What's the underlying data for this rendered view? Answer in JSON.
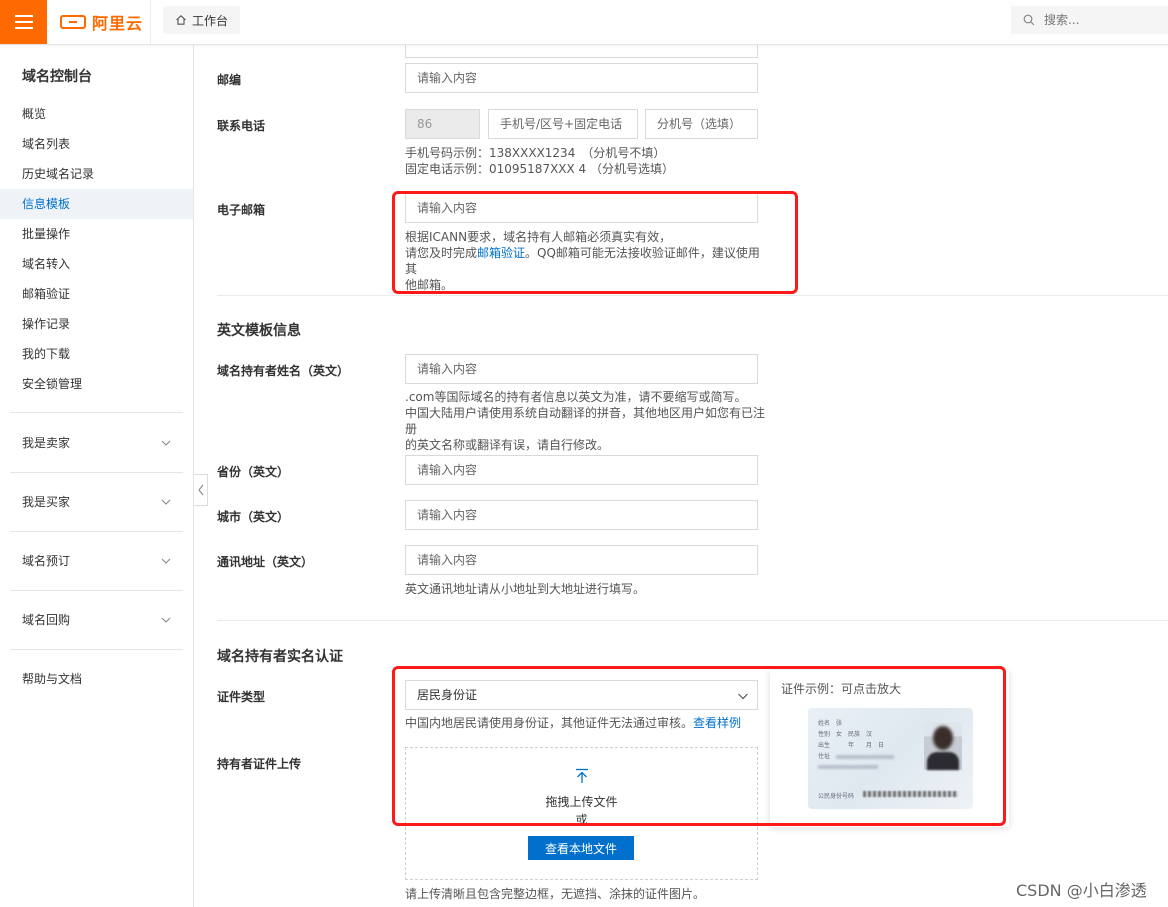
{
  "topbar": {
    "logo_text": "阿里云",
    "workbench_label": "工作台",
    "search_placeholder": "搜索..."
  },
  "sidebar": {
    "title": "域名控制台",
    "items": [
      {
        "label": "概览"
      },
      {
        "label": "域名列表"
      },
      {
        "label": "历史域名记录"
      },
      {
        "label": "信息模板"
      },
      {
        "label": "批量操作"
      },
      {
        "label": "域名转入"
      },
      {
        "label": "邮箱验证"
      },
      {
        "label": "操作记录"
      },
      {
        "label": "我的下载"
      },
      {
        "label": "安全锁管理"
      }
    ],
    "active_index": 3,
    "groups": [
      {
        "label": "我是卖家"
      },
      {
        "label": "我是买家"
      },
      {
        "label": "域名预订"
      },
      {
        "label": "域名回购"
      }
    ],
    "help_label": "帮助与文档"
  },
  "form": {
    "postcode": {
      "label": "邮编",
      "placeholder": "请输入内容"
    },
    "phone": {
      "label": "联系电话",
      "country_code": "86",
      "number_placeholder": "手机号/区号+固定电话",
      "ext_placeholder": "分机号（选填）",
      "hint_line1": "手机号码示例：138XXXX1234　（分机号不填）",
      "hint_line2": "固定电话示例：01095187XXX 4 （分机号选填）"
    },
    "email": {
      "label": "电子邮箱",
      "placeholder": "请输入内容",
      "hint_line1": "根据ICANN要求，域名持有人邮箱必须真实有效，",
      "hint_line2_pre": "请您及时完成",
      "hint_link": "邮箱验证",
      "hint_line2_post": "。QQ邮箱可能无法接收验证邮件，建议使用其",
      "hint_line3": "他邮箱。"
    },
    "english_section_title": "英文模板信息",
    "holder_name_en": {
      "label": "域名持有者姓名（英文）",
      "placeholder": "请输入内容",
      "hint_line1": ".com等国际域名的持有者信息以英文为准，请不要缩写或简写。",
      "hint_line2": "中国大陆用户请使用系统自动翻译的拼音，其他地区用户如您有已注册",
      "hint_line3": "的英文名称或翻译有误，请自行修改。"
    },
    "province_en": {
      "label": "省份（英文）",
      "placeholder": "请输入内容"
    },
    "city_en": {
      "label": "城市（英文）",
      "placeholder": "请输入内容"
    },
    "address_en": {
      "label": "通讯地址（英文）",
      "placeholder": "请输入内容",
      "hint": "英文通讯地址请从小地址到大地址进行填写。"
    },
    "verification_section_title": "域名持有者实名认证",
    "id_type": {
      "label": "证件类型",
      "selected": "居民身份证",
      "hint_pre": "中国内地居民请使用身份证，其他证件无法通过审核。",
      "hint_link": "查看样例"
    },
    "upload": {
      "label": "持有者证件上传",
      "drag_text": "拖拽上传文件",
      "or_text": "或",
      "button_label": "查看本地文件",
      "hint": "请上传清晰且包含完整边框，无遮挡、涂抹的证件图片。"
    },
    "example": {
      "title": "证件示例：可点击放大",
      "card_fields": [
        {
          "k": "姓名",
          "v": "张"
        },
        {
          "k": "性别",
          "v": "女　民族　汉"
        },
        {
          "k": "出生",
          "v": "　　年　　月　日"
        },
        {
          "k": "住址",
          "v": ""
        }
      ],
      "card_number_label": "公民身份号码"
    }
  },
  "watermark": "CSDN @小白渗透",
  "colors": {
    "brand": "#ff6a00",
    "link": "#0070cc",
    "highlight": "#ff1a1a"
  }
}
